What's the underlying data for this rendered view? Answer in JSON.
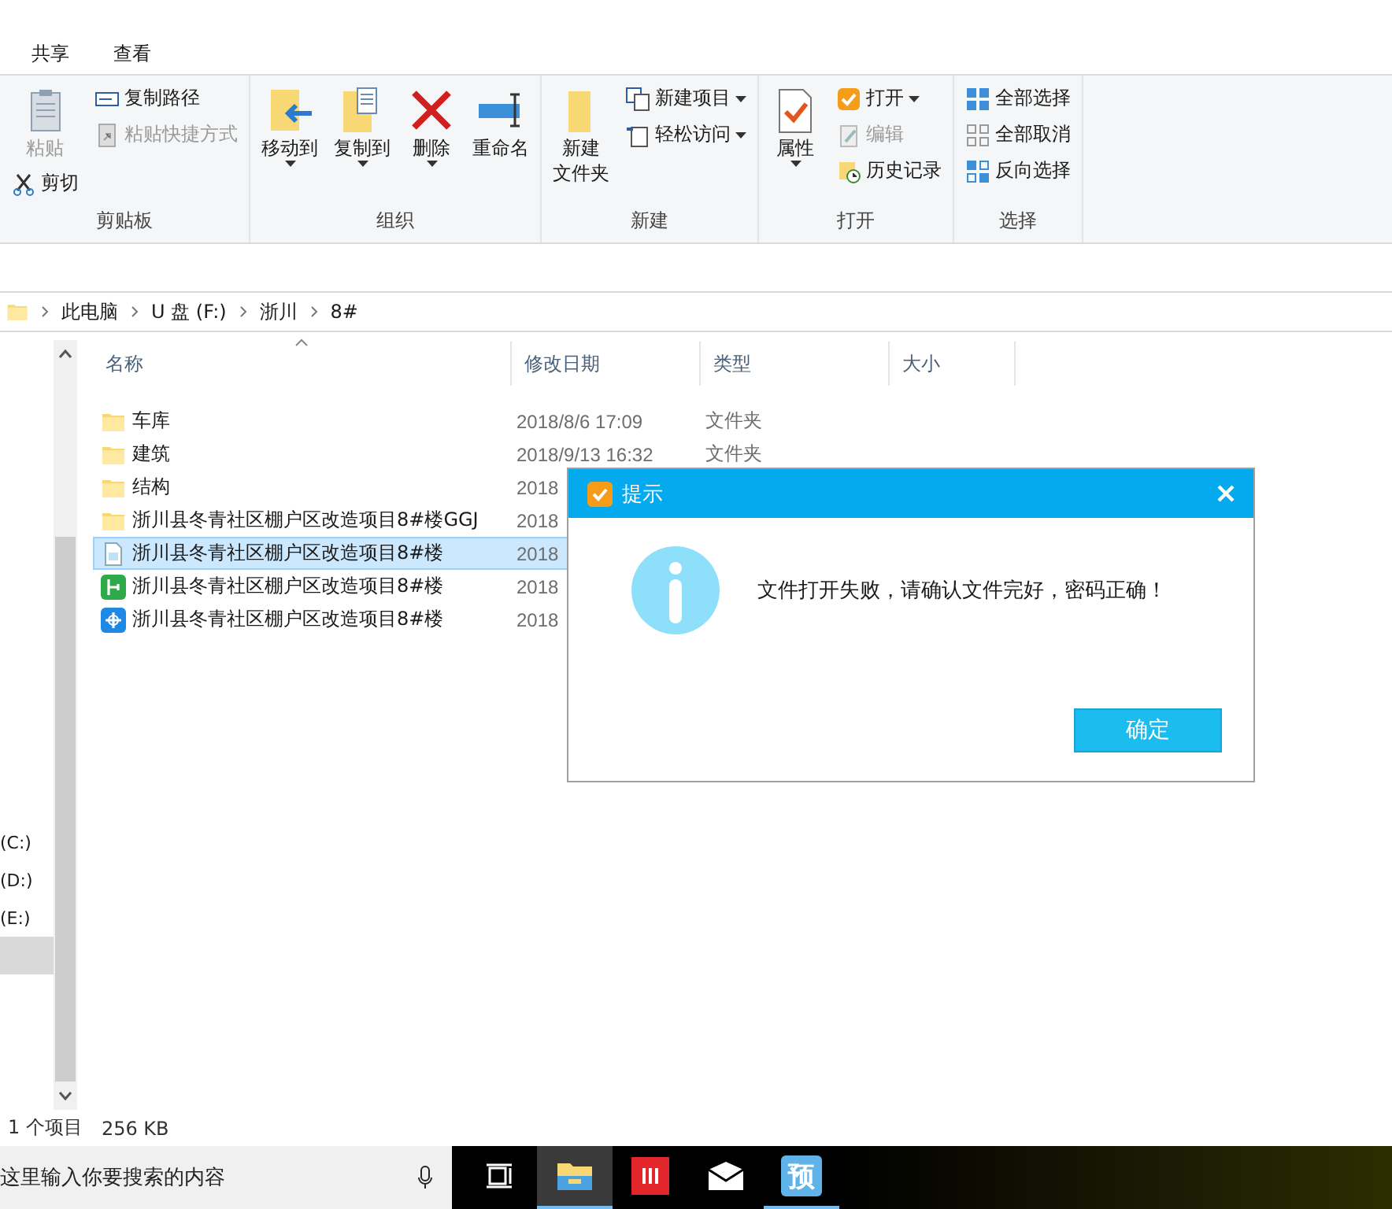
{
  "tabs": [
    {
      "label": "共享"
    },
    {
      "label": "查看"
    }
  ],
  "ribbon": [
    {
      "label": "剪贴板",
      "columns": [
        [
          {
            "kind": "large",
            "label": "粘贴",
            "disabled": true,
            "dropdown": false
          },
          {
            "kind": "small",
            "label": "剪切",
            "disabled": false,
            "dropdown": false
          }
        ],
        [
          {
            "kind": "small",
            "label": "复制路径",
            "disabled": false,
            "dropdown": false
          },
          {
            "kind": "small",
            "label": "粘贴快捷方式",
            "disabled": true,
            "dropdown": false
          }
        ]
      ]
    },
    {
      "label": "组织",
      "columns": [
        [
          {
            "kind": "large",
            "label": "移动到",
            "disabled": false,
            "dropdown": true
          }
        ],
        [
          {
            "kind": "large",
            "label": "复制到",
            "disabled": false,
            "dropdown": true
          }
        ],
        [
          {
            "kind": "large",
            "label": "删除",
            "disabled": false,
            "dropdown": true
          }
        ],
        [
          {
            "kind": "large",
            "label": "重命名",
            "disabled": false,
            "dropdown": false
          }
        ]
      ]
    },
    {
      "label": "新建",
      "columns": [
        [
          {
            "kind": "large",
            "lines": [
              "新建",
              "文件夹"
            ],
            "disabled": false,
            "dropdown": false
          }
        ],
        [
          {
            "kind": "small",
            "label": "新建项目",
            "disabled": false,
            "dropdown": true
          },
          {
            "kind": "small",
            "label": "轻松访问",
            "disabled": false,
            "dropdown": true
          }
        ]
      ]
    },
    {
      "label": "打开",
      "columns": [
        [
          {
            "kind": "large",
            "label": "属性",
            "disabled": false,
            "dropdown": true
          }
        ],
        [
          {
            "kind": "small",
            "label": "打开",
            "disabled": false,
            "dropdown": true
          },
          {
            "kind": "small",
            "label": "编辑",
            "disabled": true,
            "dropdown": false
          },
          {
            "kind": "small",
            "label": "历史记录",
            "disabled": false,
            "dropdown": false
          }
        ]
      ]
    },
    {
      "label": "选择",
      "columns": [
        [
          {
            "kind": "small",
            "label": "全部选择",
            "disabled": false,
            "dropdown": false
          },
          {
            "kind": "small",
            "label": "全部取消",
            "disabled": false,
            "dropdown": false
          },
          {
            "kind": "small",
            "label": "反向选择",
            "disabled": false,
            "dropdown": false
          }
        ]
      ]
    }
  ],
  "breadcrumb": [
    "此电脑",
    "U 盘 (F:)",
    "浙川",
    "8#"
  ],
  "nav": [
    {
      "label": "(C:)",
      "selected": false
    },
    {
      "label": "(D:)",
      "selected": false
    },
    {
      "label": "(E:)",
      "selected": false
    },
    {
      "selected": true
    }
  ],
  "columns": [
    "名称",
    "修改日期",
    "类型",
    "大小"
  ],
  "rows": [
    {
      "kind": "folder",
      "name": "车库",
      "date": "2018/8/6 17:09",
      "type": "文件夹",
      "selected": false
    },
    {
      "kind": "folder",
      "name": "建筑",
      "date": "2018/9/13 16:32",
      "type": "文件夹",
      "selected": false
    },
    {
      "kind": "folder",
      "name": "结构",
      "date": "2018",
      "selected": false
    },
    {
      "kind": "folder",
      "name": "浙川县冬青社区棚户区改造项目8#楼GGJ",
      "date": "2018",
      "selected": false
    },
    {
      "kind": "document",
      "name": "浙川县冬青社区棚户区改造项目8#楼",
      "date": "2018",
      "selected": true
    },
    {
      "kind": "green-app",
      "name": "浙川县冬青社区棚户区改造项目8#楼",
      "date": "2018",
      "selected": false
    },
    {
      "kind": "blue-app",
      "name": "浙川县冬青社区棚户区改造项目8#楼",
      "date": "2018",
      "selected": false
    }
  ],
  "status_bar": {
    "count": "1 个项目",
    "size": "256 KB"
  },
  "dialog": {
    "title": "提示",
    "message": "文件打开失败，请确认文件完好，密码正确！",
    "button": "确定"
  },
  "taskbar": {
    "search_placeholder": "这里输入你要搜索的内容",
    "apps": [
      {
        "kind": "task-view",
        "selected": false,
        "running": false
      },
      {
        "kind": "explorer",
        "selected": true,
        "running": true
      },
      {
        "kind": "red-app",
        "selected": false,
        "running": false
      },
      {
        "kind": "mail",
        "selected": false,
        "running": false
      },
      {
        "kind": "letter-app",
        "label": "预",
        "selected": false,
        "running": true
      }
    ]
  }
}
